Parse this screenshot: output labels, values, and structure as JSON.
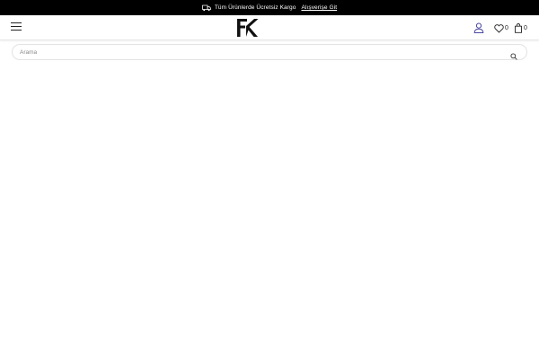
{
  "announcement": {
    "text": "Tüm Ürünlerde Ücretsiz Kargo",
    "link": "Alışverişe Git"
  },
  "header": {
    "logo_icon": "fk-logo-icon",
    "wishlist_count": "0",
    "cart_count": "0",
    "accent_color": "#4a47a3"
  },
  "search": {
    "placeholder": "Arama"
  }
}
